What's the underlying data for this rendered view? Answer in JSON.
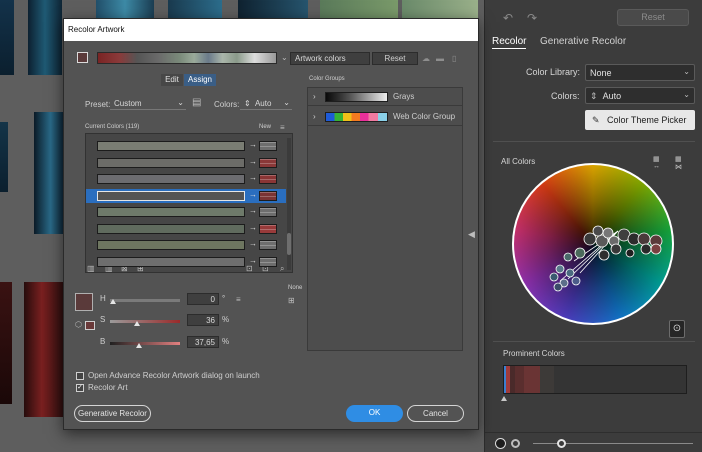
{
  "dialog": {
    "title": "Recolor Artwork",
    "artwork_colors_field": "Artwork colors",
    "reset_label": "Reset",
    "tabs": [
      {
        "label": "Edit"
      },
      {
        "label": "Assign"
      }
    ],
    "preset_label": "Preset:",
    "preset_value": "Custom",
    "colors_label": "Colors:",
    "colors_value": "Auto",
    "current_colors_label": "Current Colors (119)",
    "new_label": "New",
    "color_groups_label": "Color Groups",
    "groups": [
      {
        "label": "Grays"
      },
      {
        "label": "Web Color Group"
      }
    ],
    "none_label": "None",
    "h_label": "H",
    "h_value": "0",
    "h_unit": "°",
    "s_label": "S",
    "s_value": "36",
    "s_unit": "%",
    "b_label": "B",
    "b_value": "37,65",
    "b_unit": "%",
    "open_advanced_label": "Open Advance Recolor Artwork dialog on launch",
    "recolor_art_label": "Recolor Art",
    "generative_button": "Generative Recolor",
    "ok_button": "OK",
    "cancel_button": "Cancel",
    "current_rows": [
      {
        "current": "#7a7d73",
        "new": "#6e6e6e"
      },
      {
        "current": "#6c6c68",
        "new": "#8a3838"
      },
      {
        "current": "#6c6c70",
        "new": "#8a3535"
      },
      {
        "current": "#545454",
        "new": "#7a3434"
      },
      {
        "current": "#6e7a6a",
        "new": "#6e6e6e"
      },
      {
        "current": "#606b5e",
        "new": "#983a3a"
      },
      {
        "current": "#6e7660",
        "new": "#6e6e6e"
      },
      {
        "current": "#6e6e6e",
        "new": "#6e6e6e"
      }
    ],
    "colors": {
      "accent": "#2f8de4",
      "selected_row": "#2a6ebf",
      "current_swatch": "#5a3a3a"
    }
  },
  "panel": {
    "reset_label": "Reset",
    "tab_recolor": "Recolor",
    "tab_generative": "Generative Recolor",
    "library_label": "Color Library:",
    "library_value": "None",
    "colors_label": "Colors:",
    "colors_value": "Auto",
    "theme_picker_label": "Color Theme Picker",
    "all_colors_label": "All Colors",
    "prominent_label": "Prominent Colors"
  },
  "icons": {
    "eyedropper": "eyedropper-icon",
    "link": "link-icon",
    "undo": "undo-icon",
    "redo": "redo-icon"
  }
}
